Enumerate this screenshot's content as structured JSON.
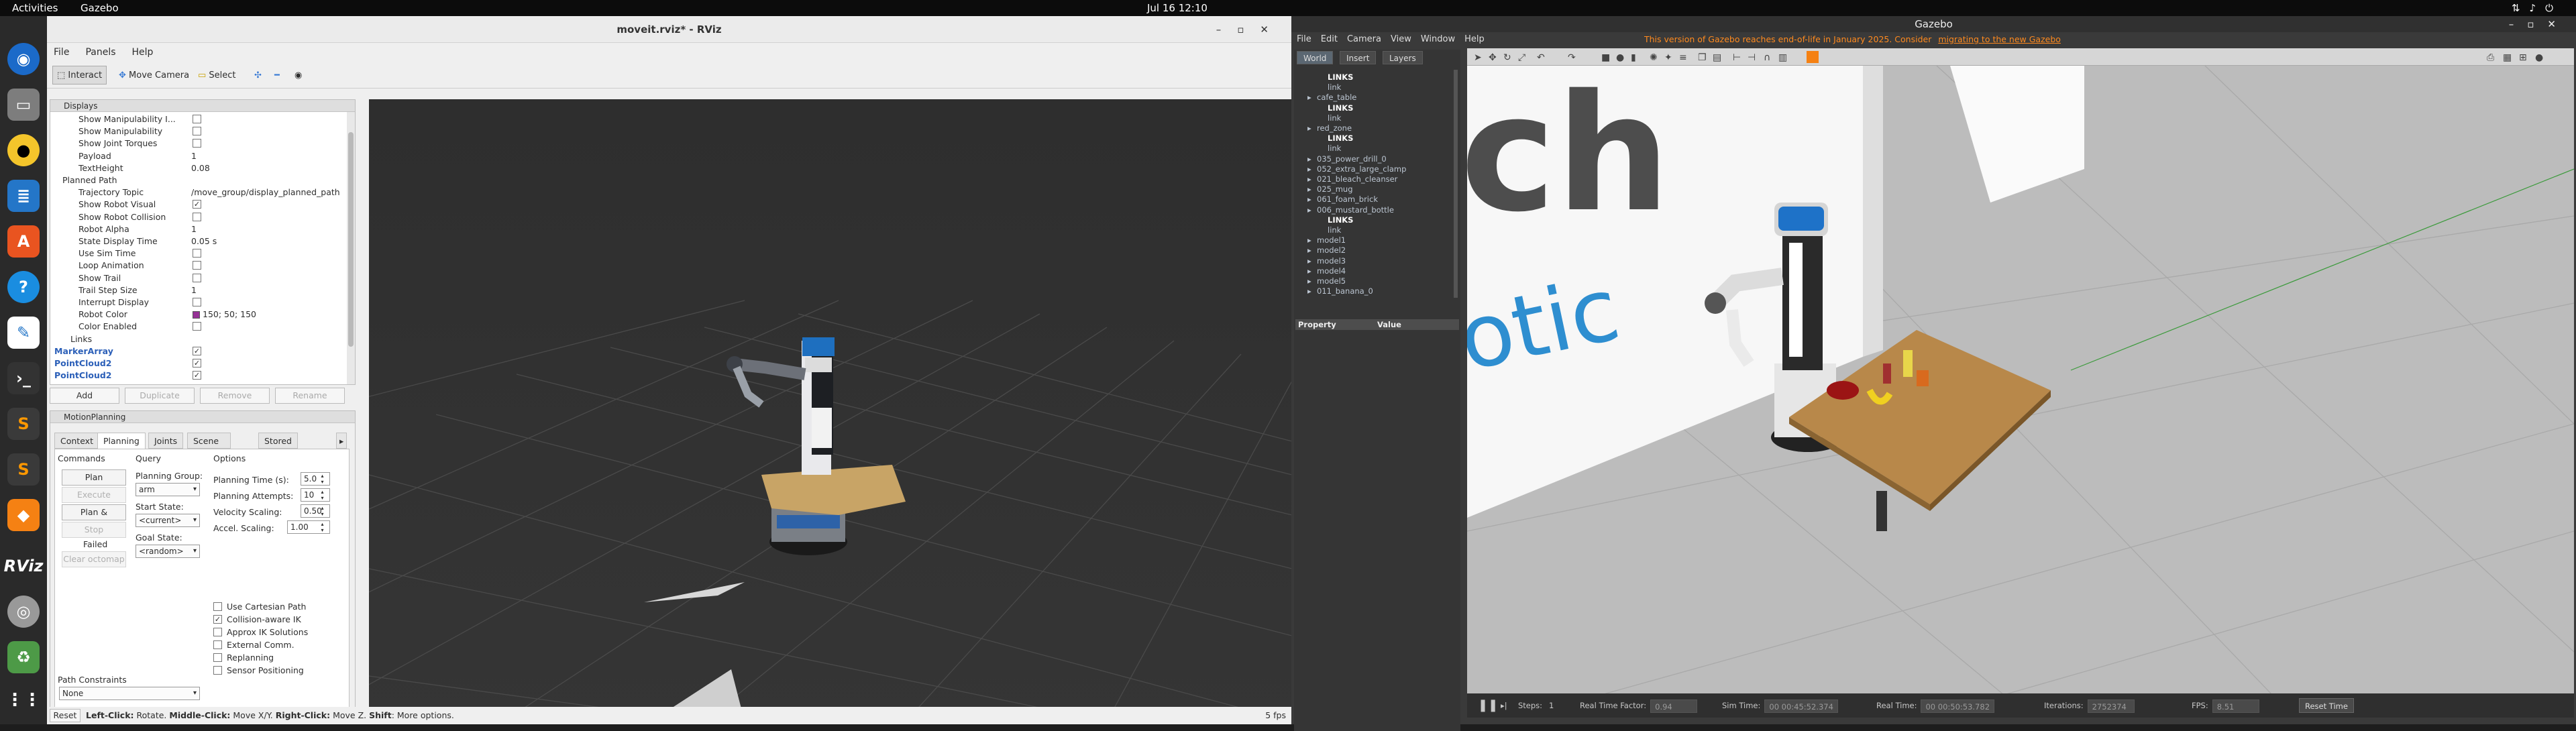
{
  "topbar": {
    "activities": "Activities",
    "app": "Gazebo",
    "clock": "Jul 16  12:10"
  },
  "rviz": {
    "title": "moveit.rviz* - RViz",
    "menu": [
      "File",
      "Panels",
      "Help"
    ],
    "toolbar": {
      "interact": "Interact",
      "move_camera": "Move Camera",
      "select": "Select"
    },
    "displays": {
      "title": "Displays",
      "rows": [
        {
          "label": "Show Manipulability I...",
          "value": ""
        },
        {
          "label": "Show Manipulability",
          "value": ""
        },
        {
          "label": "Show Joint Torques",
          "value": ""
        },
        {
          "label": "Payload",
          "value": "1"
        },
        {
          "label": "TextHeight",
          "value": "0.08"
        },
        {
          "label": "Planned Path",
          "value": ""
        },
        {
          "label": "Trajectory Topic",
          "value": "/move_group/display_planned_path"
        },
        {
          "label": "Show Robot Visual",
          "value": "✓"
        },
        {
          "label": "Show Robot Collision",
          "value": ""
        },
        {
          "label": "Robot Alpha",
          "value": "1"
        },
        {
          "label": "State Display Time",
          "value": "0.05 s"
        },
        {
          "label": "Use Sim Time",
          "value": ""
        },
        {
          "label": "Loop Animation",
          "value": ""
        },
        {
          "label": "Show Trail",
          "value": ""
        },
        {
          "label": "Trail Step Size",
          "value": "1"
        },
        {
          "label": "Interrupt Display",
          "value": ""
        },
        {
          "label": "Robot Color",
          "value": "150; 50; 150"
        },
        {
          "label": "Color Enabled",
          "value": ""
        },
        {
          "label": "Links",
          "value": ""
        },
        {
          "label": "MarkerArray",
          "value": "✓"
        },
        {
          "label": "PointCloud2",
          "value": "✓"
        },
        {
          "label": "PointCloud2",
          "value": "✓"
        }
      ],
      "buttons": [
        "Add",
        "Duplicate",
        "Remove",
        "Rename"
      ]
    },
    "motion_planning": {
      "title": "MotionPlanning",
      "tabs": [
        "Context",
        "Planning",
        "Joints",
        "Scene Objects",
        "Stored Scene"
      ],
      "commands_label": "Commands",
      "query_label": "Query",
      "options_label": "Options",
      "buttons": [
        "Plan",
        "Execute",
        "Plan & Execute",
        "Stop",
        "Clear octomap"
      ],
      "status": "Failed",
      "planning_group_label": "Planning Group:",
      "planning_group": "arm",
      "start_state_label": "Start State:",
      "start_state": "<current>",
      "goal_state_label": "Goal State:",
      "goal_state": "<random>",
      "options": [
        {
          "label": "Planning Time (s):",
          "value": "5.0"
        },
        {
          "label": "Planning Attempts:",
          "value": "10"
        },
        {
          "label": "Velocity Scaling:",
          "value": "0.50"
        },
        {
          "label": "Accel. Scaling:",
          "value": "1.00"
        }
      ],
      "checks": [
        {
          "label": "Use Cartesian Path",
          "value": ""
        },
        {
          "label": "Collision-aware IK",
          "value": "✓"
        },
        {
          "label": "Approx IK Solutions",
          "value": ""
        },
        {
          "label": "External Comm.",
          "value": ""
        },
        {
          "label": "Replanning",
          "value": ""
        },
        {
          "label": "Sensor Positioning",
          "value": ""
        }
      ],
      "path_constraints_label": "Path Constraints",
      "path_constraints": "None"
    },
    "status": {
      "reset": "Reset",
      "hint_left": "Left-Click:",
      "hint_left_text": " Rotate. ",
      "hint_middle": "Middle-Click:",
      "hint_middle_text": " Move X/Y. ",
      "hint_right": "Right-Click:",
      "hint_right_text": " Move Z. ",
      "hint_shift": "Shift",
      "hint_shift_text": ": More options.",
      "fps": "5 fps"
    }
  },
  "gazebo": {
    "title": "Gazebo",
    "menu": [
      "File",
      "Edit",
      "Camera",
      "View",
      "Window",
      "Help"
    ],
    "warning": "This version of Gazebo reaches end-of-life in January 2025. Consider ",
    "warning_link": "migrating to the new Gazebo",
    "tabs": [
      "World",
      "Insert",
      "Layers"
    ],
    "tree": [
      {
        "t": "LINKS",
        "b": true,
        "i": 2
      },
      {
        "t": "link",
        "b": false,
        "i": 2
      },
      {
        "t": "cafe_table",
        "b": false,
        "i": 1
      },
      {
        "t": "LINKS",
        "b": true,
        "i": 2
      },
      {
        "t": "link",
        "b": false,
        "i": 2
      },
      {
        "t": "red_zone",
        "b": false,
        "i": 1
      },
      {
        "t": "LINKS",
        "b": true,
        "i": 2
      },
      {
        "t": "link",
        "b": false,
        "i": 2
      },
      {
        "t": "035_power_drill_0",
        "b": false,
        "i": 1
      },
      {
        "t": "052_extra_large_clamp",
        "b": false,
        "i": 1
      },
      {
        "t": "021_bleach_cleanser",
        "b": false,
        "i": 1
      },
      {
        "t": "025_mug",
        "b": false,
        "i": 1
      },
      {
        "t": "061_foam_brick",
        "b": false,
        "i": 1
      },
      {
        "t": "006_mustard_bottle",
        "b": false,
        "i": 1
      },
      {
        "t": "LINKS",
        "b": true,
        "i": 2
      },
      {
        "t": "link",
        "b": false,
        "i": 2
      },
      {
        "t": "model1",
        "b": false,
        "i": 1
      },
      {
        "t": "model2",
        "b": false,
        "i": 1
      },
      {
        "t": "model3",
        "b": false,
        "i": 1
      },
      {
        "t": "model4",
        "b": false,
        "i": 1
      },
      {
        "t": "model5",
        "b": false,
        "i": 1
      },
      {
        "t": "011_banana_0",
        "b": false,
        "i": 1
      }
    ],
    "property": "Property",
    "value": "Value",
    "bottom": {
      "steps_label": "Steps:",
      "steps": "1",
      "rtf_label": "Real Time Factor:",
      "rtf": "0.94",
      "sim_time_label": "Sim Time:",
      "sim_time": "00 00:45:52.374",
      "real_time_label": "Real Time:",
      "real_time": "00 00:50:53.782",
      "iterations_label": "Iterations:",
      "iterations": "2752374",
      "fps_label": "FPS:",
      "fps": "8.51",
      "reset": "Reset Time"
    }
  },
  "viewport_scene": {
    "logo_text": "otic"
  }
}
